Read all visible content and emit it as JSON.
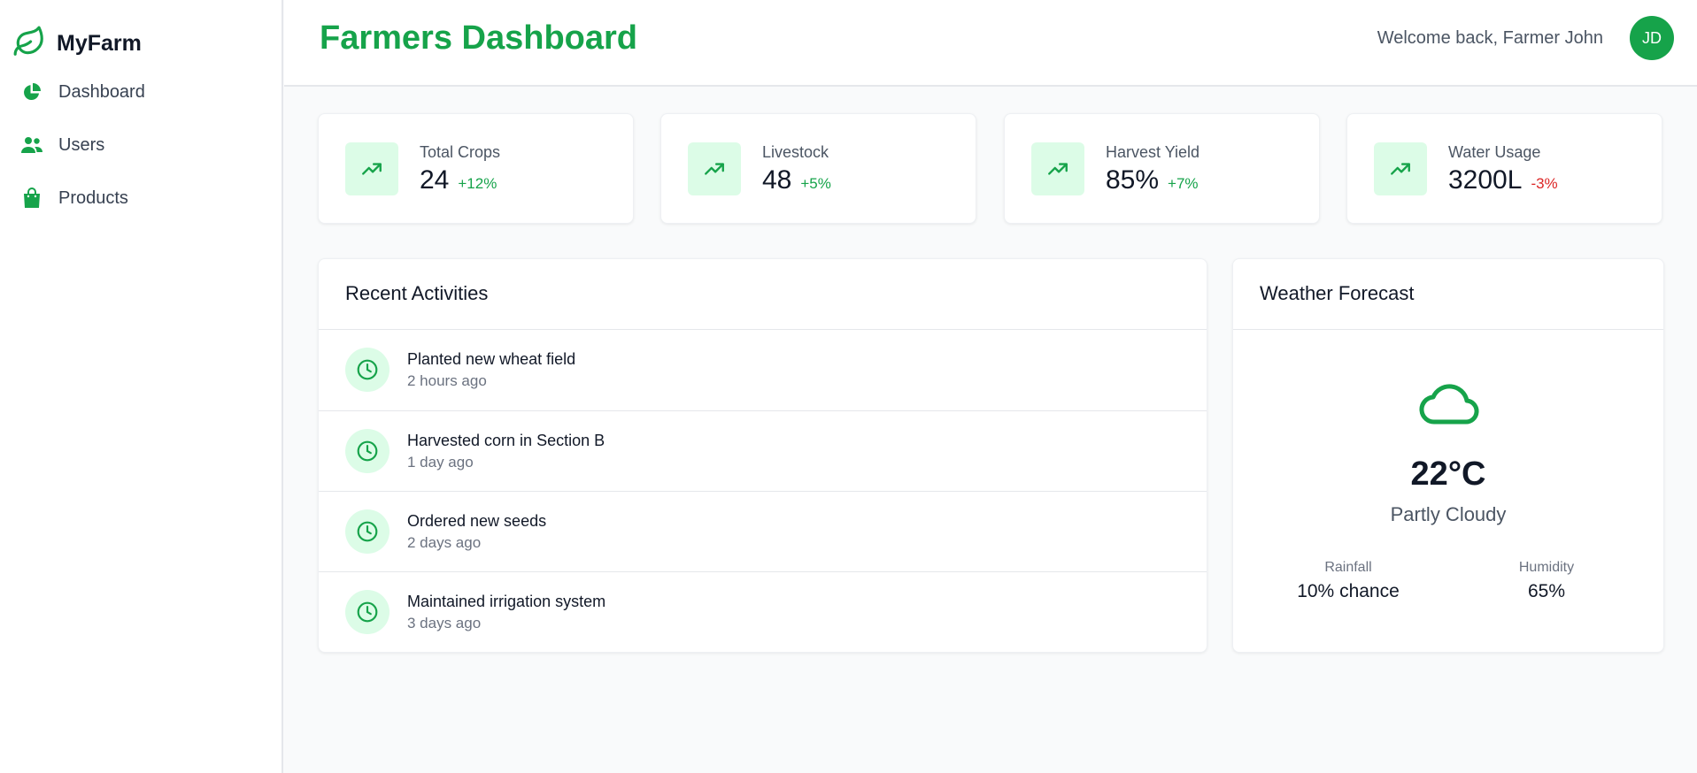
{
  "sidebar": {
    "brand": "MyFarm",
    "items": [
      {
        "label": "Dashboard",
        "icon": "pie-chart-icon"
      },
      {
        "label": "Users",
        "icon": "users-icon"
      },
      {
        "label": "Products",
        "icon": "shopping-bag-icon"
      }
    ]
  },
  "header": {
    "title": "Farmers Dashboard",
    "welcome": "Welcome back, Farmer John",
    "avatar_initials": "JD"
  },
  "stats": [
    {
      "label": "Total Crops",
      "value": "24",
      "change": "+12%",
      "trend": "positive"
    },
    {
      "label": "Livestock",
      "value": "48",
      "change": "+5%",
      "trend": "positive"
    },
    {
      "label": "Harvest Yield",
      "value": "85%",
      "change": "+7%",
      "trend": "positive"
    },
    {
      "label": "Water Usage",
      "value": "3200L",
      "change": "-3%",
      "trend": "negative"
    }
  ],
  "activities": {
    "title": "Recent Activities",
    "items": [
      {
        "title": "Planted new wheat field",
        "time": "2 hours ago"
      },
      {
        "title": "Harvested corn in Section B",
        "time": "1 day ago"
      },
      {
        "title": "Ordered new seeds",
        "time": "2 days ago"
      },
      {
        "title": "Maintained irrigation system",
        "time": "3 days ago"
      }
    ]
  },
  "weather": {
    "title": "Weather Forecast",
    "temperature": "22°C",
    "condition": "Partly Cloudy",
    "rainfall_label": "Rainfall",
    "rainfall_value": "10% chance",
    "humidity_label": "Humidity",
    "humidity_value": "65%"
  },
  "colors": {
    "accent": "#16a34a",
    "accent_light": "#dcfce7",
    "negative": "#dc2626",
    "background": "#f9fafb"
  }
}
